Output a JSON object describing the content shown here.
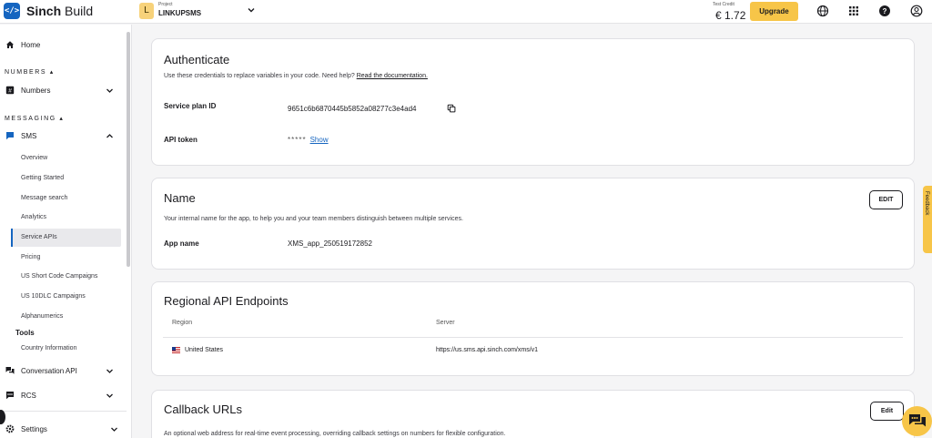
{
  "topbar": {
    "brand_bold": "Sinch",
    "brand_light": "Build",
    "project_initial": "L",
    "project_caption": "Project",
    "project_name": "LINKUPSMS",
    "credit_label": "Test Credit",
    "credit_value": "€ 1.72",
    "upgrade_label": "Upgrade",
    "icons": [
      "globe-icon",
      "apps-grid-icon",
      "help-icon",
      "account-icon"
    ]
  },
  "sidebar": {
    "home": "Home",
    "section_numbers": "NUMBERS",
    "numbers": "Numbers",
    "section_messaging": "MESSAGING",
    "sms": "SMS",
    "sms_items": [
      "Overview",
      "Getting Started",
      "Message search",
      "Analytics",
      "Service APIs",
      "Pricing",
      "US Short Code Campaigns",
      "US 10DLC Campaigns",
      "Alphanumerics"
    ],
    "tools": "Tools",
    "country_information": "Country Information",
    "conversation_api": "Conversation API",
    "rcs": "RCS",
    "settings": "Settings",
    "active_item": "Service APIs"
  },
  "authenticate": {
    "title": "Authenticate",
    "desc": "Use these credentials to replace variables in your code. Need help?",
    "doc_link": "Read the documentation.",
    "service_plan_label": "Service plan ID",
    "service_plan_value": "9651c6b6870445b5852a08277c3e4ad4",
    "api_token_label": "API token",
    "api_token_mask": "*****",
    "show_label": "Show"
  },
  "name_card": {
    "title": "Name",
    "edit_label": "EDIT",
    "desc": "Your internal name for the app, to help you and your team members distinguish between multiple services.",
    "app_name_label": "App name",
    "app_name_value": "XMS_app_250519172852"
  },
  "regional": {
    "title": "Regional API Endpoints",
    "headers": [
      "Region",
      "Server"
    ],
    "rows": [
      {
        "region": "United States",
        "server": "https://us.sms.api.sinch.com/xms/v1"
      }
    ]
  },
  "callback": {
    "title": "Callback URLs",
    "edit_label": "Edit",
    "desc": "An optional web address for real-time event processing, overriding callback settings on numbers for flexible configuration."
  },
  "feedback_label": "Feedback",
  "colors": {
    "accent": "#1565c0",
    "upgrade": "#f7c548"
  }
}
